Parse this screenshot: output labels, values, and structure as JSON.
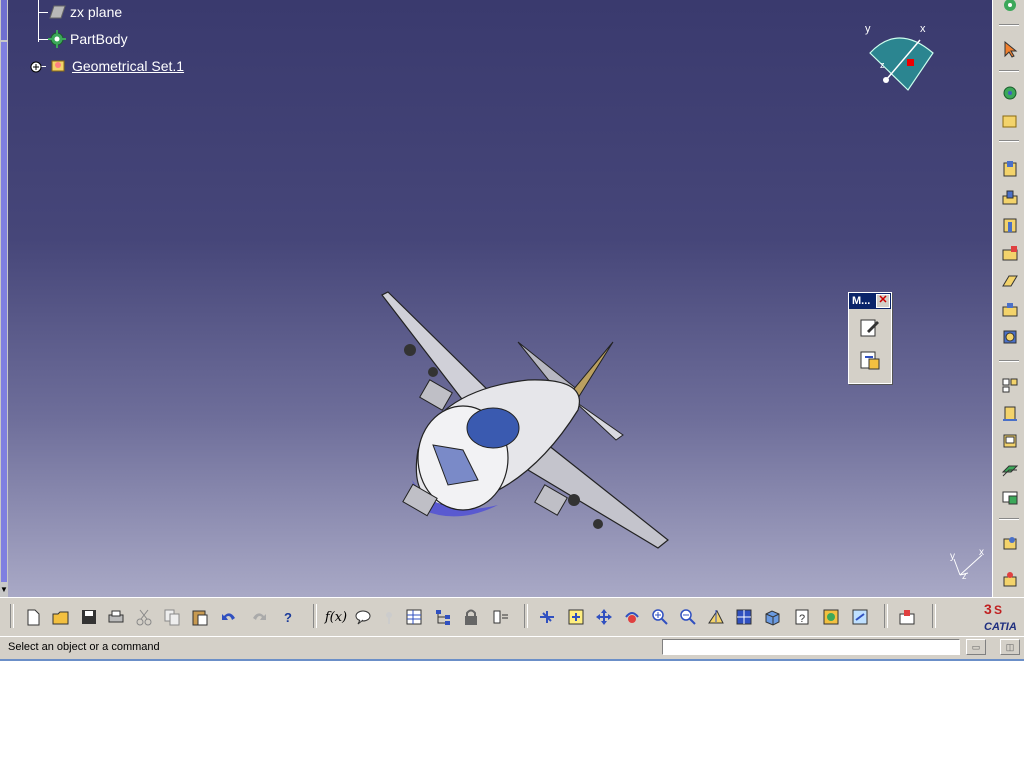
{
  "tree": {
    "items": [
      {
        "label": "zx plane",
        "icon": "plane-icon"
      },
      {
        "label": "PartBody",
        "icon": "gear-icon"
      },
      {
        "label": "Geometrical Set.1",
        "icon": "geometrical-set-icon"
      }
    ]
  },
  "compass": {
    "x": "x",
    "y": "y",
    "z": "z"
  },
  "small_axis": {
    "x": "x",
    "y": "y",
    "z": "z"
  },
  "mini_toolbar": {
    "title": "M...",
    "close": "✕"
  },
  "toolbar": {
    "fx_label": "f(x)",
    "help_label": "?"
  },
  "status": {
    "message": "Select an object or a command",
    "command_value": ""
  },
  "brand": {
    "logo_text": "CATIA"
  },
  "colors": {
    "viewport_top": "#3a3a6e",
    "viewport_bottom": "#a9a9c6",
    "accent": "#0a246a"
  }
}
